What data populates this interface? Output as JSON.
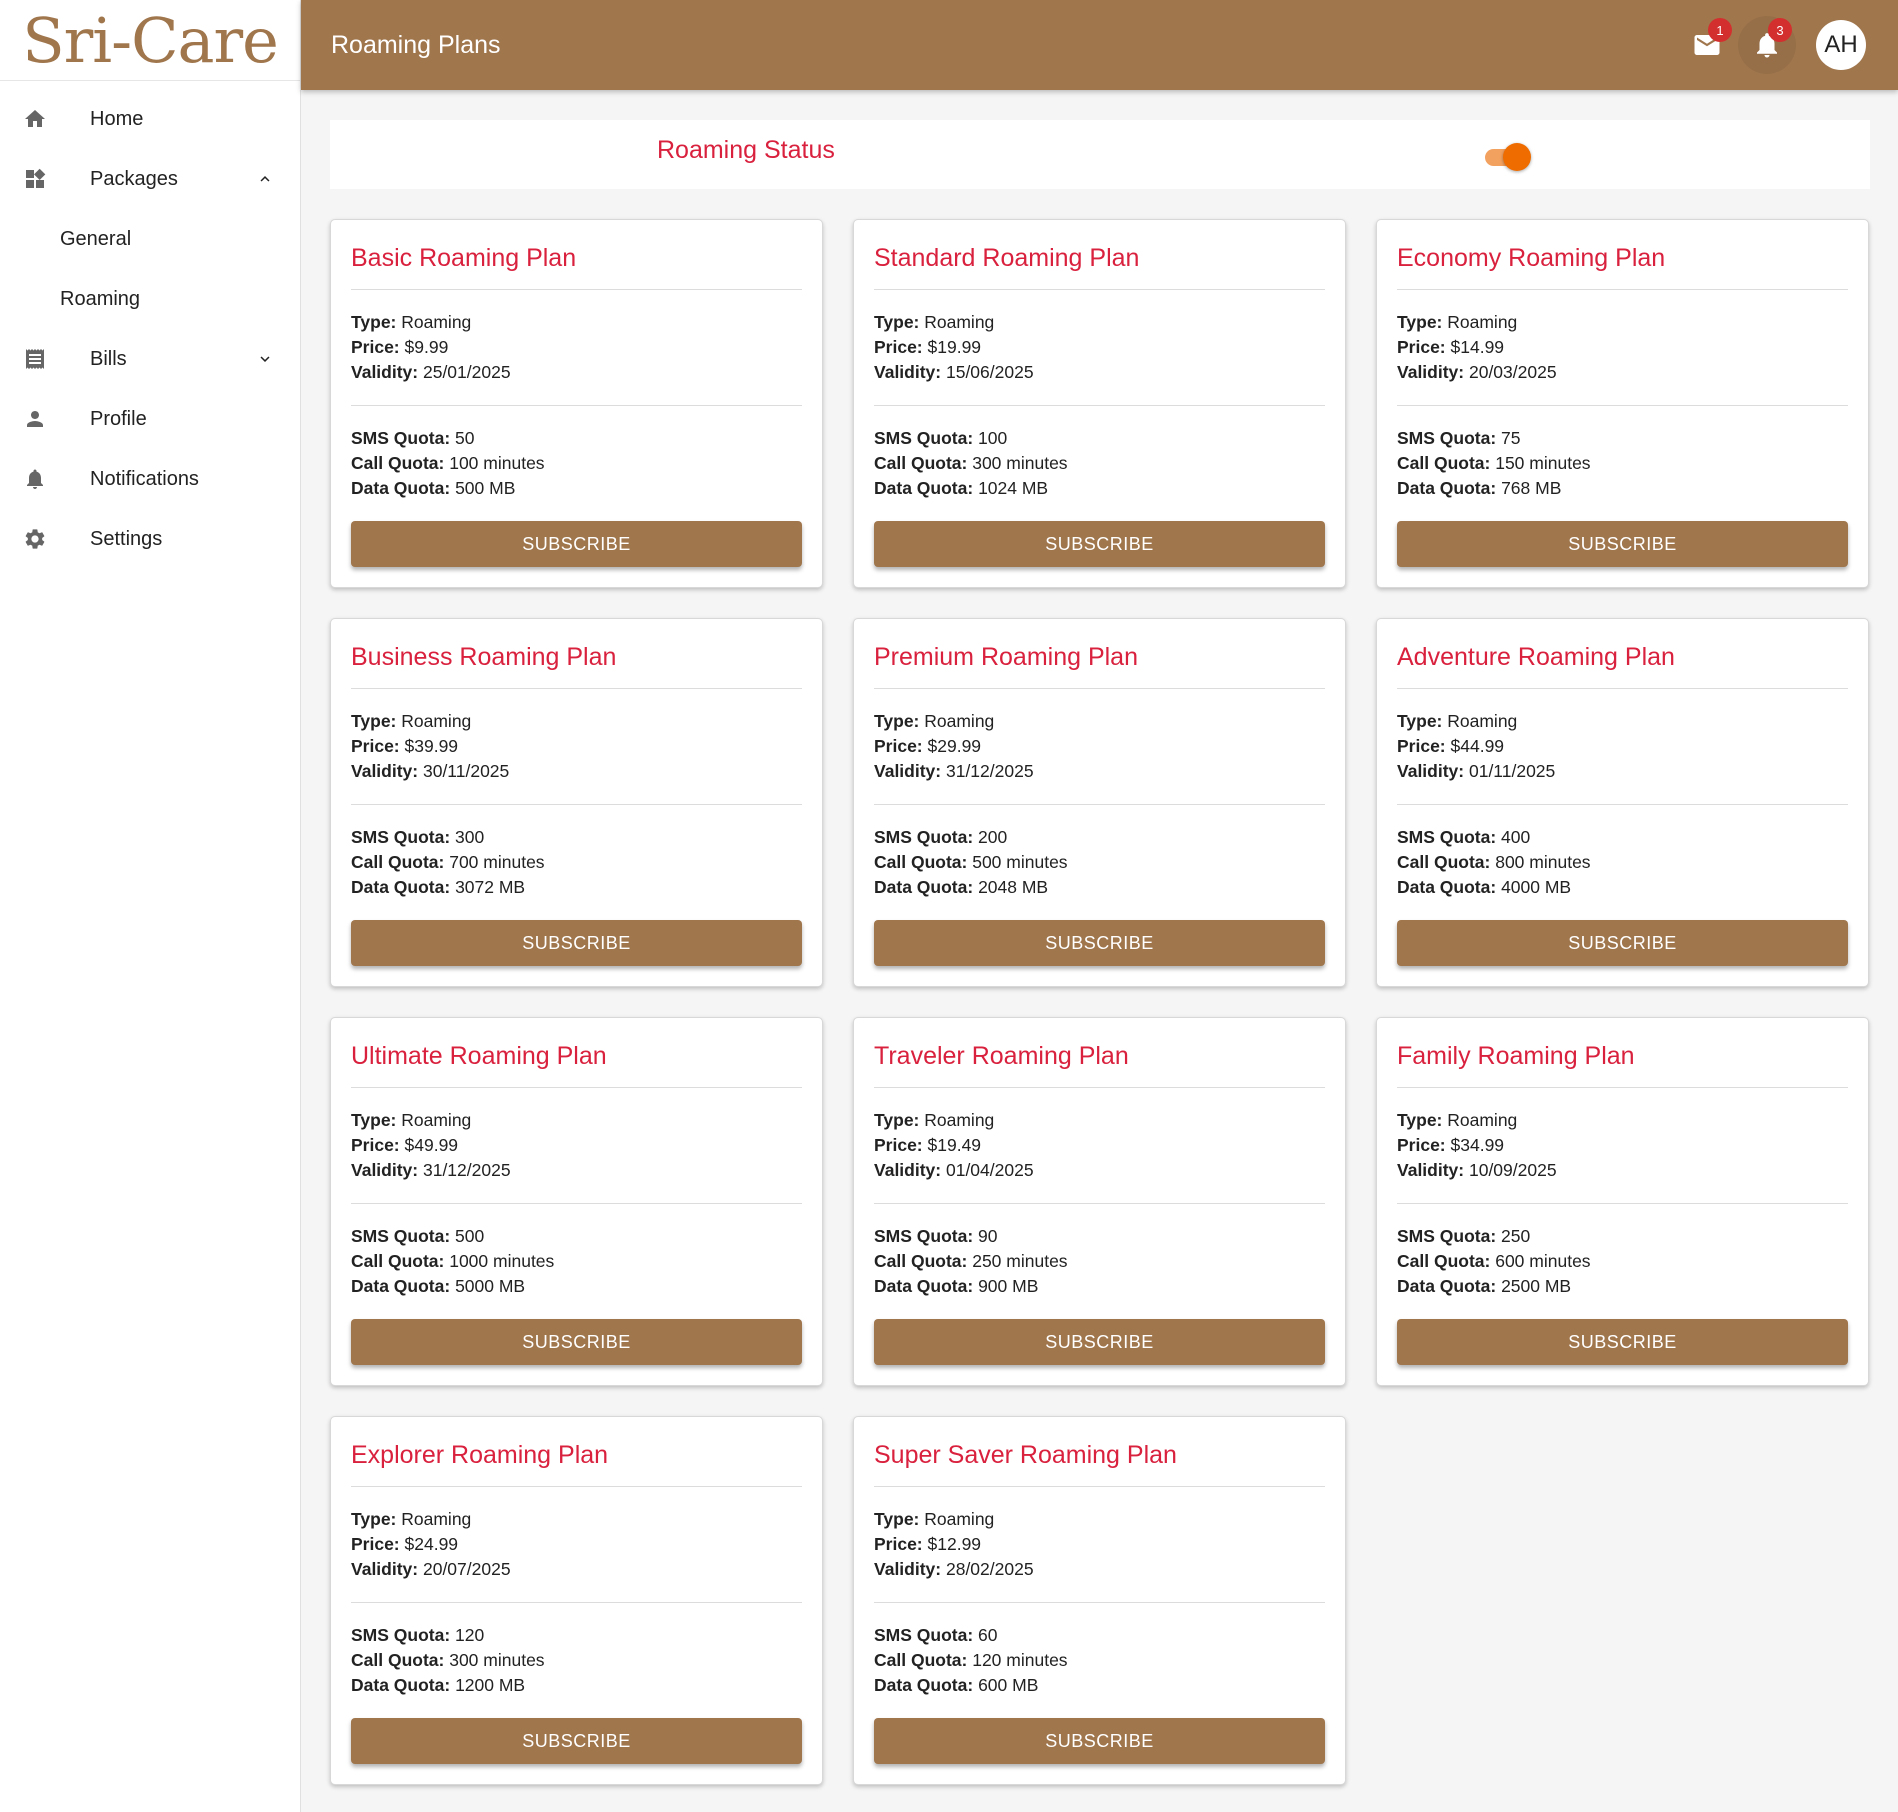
{
  "app": {
    "logo": "Sri-Care"
  },
  "sidebar": {
    "items": [
      {
        "label": "Home",
        "icon": "home-icon"
      },
      {
        "label": "Packages",
        "icon": "packages-icon",
        "expanded": true
      },
      {
        "label": "General"
      },
      {
        "label": "Roaming"
      },
      {
        "label": "Bills",
        "icon": "bills-icon",
        "expanded": false
      },
      {
        "label": "Profile",
        "icon": "person-icon"
      },
      {
        "label": "Notifications",
        "icon": "bell-icon"
      },
      {
        "label": "Settings",
        "icon": "gear-icon"
      }
    ]
  },
  "header": {
    "title": "Roaming Plans",
    "mail_badge": "1",
    "notifications_badge": "3",
    "avatar_initials": "AH"
  },
  "roaming": {
    "label": "Roaming Status",
    "enabled": true
  },
  "labels": {
    "type": "Type:",
    "price": "Price:",
    "validity": "Validity:",
    "sms": "SMS Quota:",
    "call": "Call Quota:",
    "data": "Data Quota:",
    "subscribe": "SUBSCRIBE"
  },
  "plans": [
    {
      "name": "Basic Roaming Plan",
      "type": "Roaming",
      "price": "$9.99",
      "validity": "25/01/2025",
      "sms": "50",
      "call": "100 minutes",
      "data": "500 MB"
    },
    {
      "name": "Standard Roaming Plan",
      "type": "Roaming",
      "price": "$19.99",
      "validity": "15/06/2025",
      "sms": "100",
      "call": "300 minutes",
      "data": "1024 MB"
    },
    {
      "name": "Economy Roaming Plan",
      "type": "Roaming",
      "price": "$14.99",
      "validity": "20/03/2025",
      "sms": "75",
      "call": "150 minutes",
      "data": "768 MB"
    },
    {
      "name": "Business Roaming Plan",
      "type": "Roaming",
      "price": "$39.99",
      "validity": "30/11/2025",
      "sms": "300",
      "call": "700 minutes",
      "data": "3072 MB"
    },
    {
      "name": "Premium Roaming Plan",
      "type": "Roaming",
      "price": "$29.99",
      "validity": "31/12/2025",
      "sms": "200",
      "call": "500 minutes",
      "data": "2048 MB"
    },
    {
      "name": "Adventure Roaming Plan",
      "type": "Roaming",
      "price": "$44.99",
      "validity": "01/11/2025",
      "sms": "400",
      "call": "800 minutes",
      "data": "4000 MB"
    },
    {
      "name": "Ultimate Roaming Plan",
      "type": "Roaming",
      "price": "$49.99",
      "validity": "31/12/2025",
      "sms": "500",
      "call": "1000 minutes",
      "data": "5000 MB"
    },
    {
      "name": "Traveler Roaming Plan",
      "type": "Roaming",
      "price": "$19.49",
      "validity": "01/04/2025",
      "sms": "90",
      "call": "250 minutes",
      "data": "900 MB"
    },
    {
      "name": "Family Roaming Plan",
      "type": "Roaming",
      "price": "$34.99",
      "validity": "10/09/2025",
      "sms": "250",
      "call": "600 minutes",
      "data": "2500 MB"
    },
    {
      "name": "Explorer Roaming Plan",
      "type": "Roaming",
      "price": "$24.99",
      "validity": "20/07/2025",
      "sms": "120",
      "call": "300 minutes",
      "data": "1200 MB"
    },
    {
      "name": "Super Saver Roaming Plan",
      "type": "Roaming",
      "price": "$12.99",
      "validity": "28/02/2025",
      "sms": "60",
      "call": "120 minutes",
      "data": "600 MB"
    }
  ],
  "colors": {
    "brand": "#a0764d",
    "title_red": "#d9213e",
    "toggle_on": "#ef6c00",
    "badge": "#d32f2f"
  }
}
